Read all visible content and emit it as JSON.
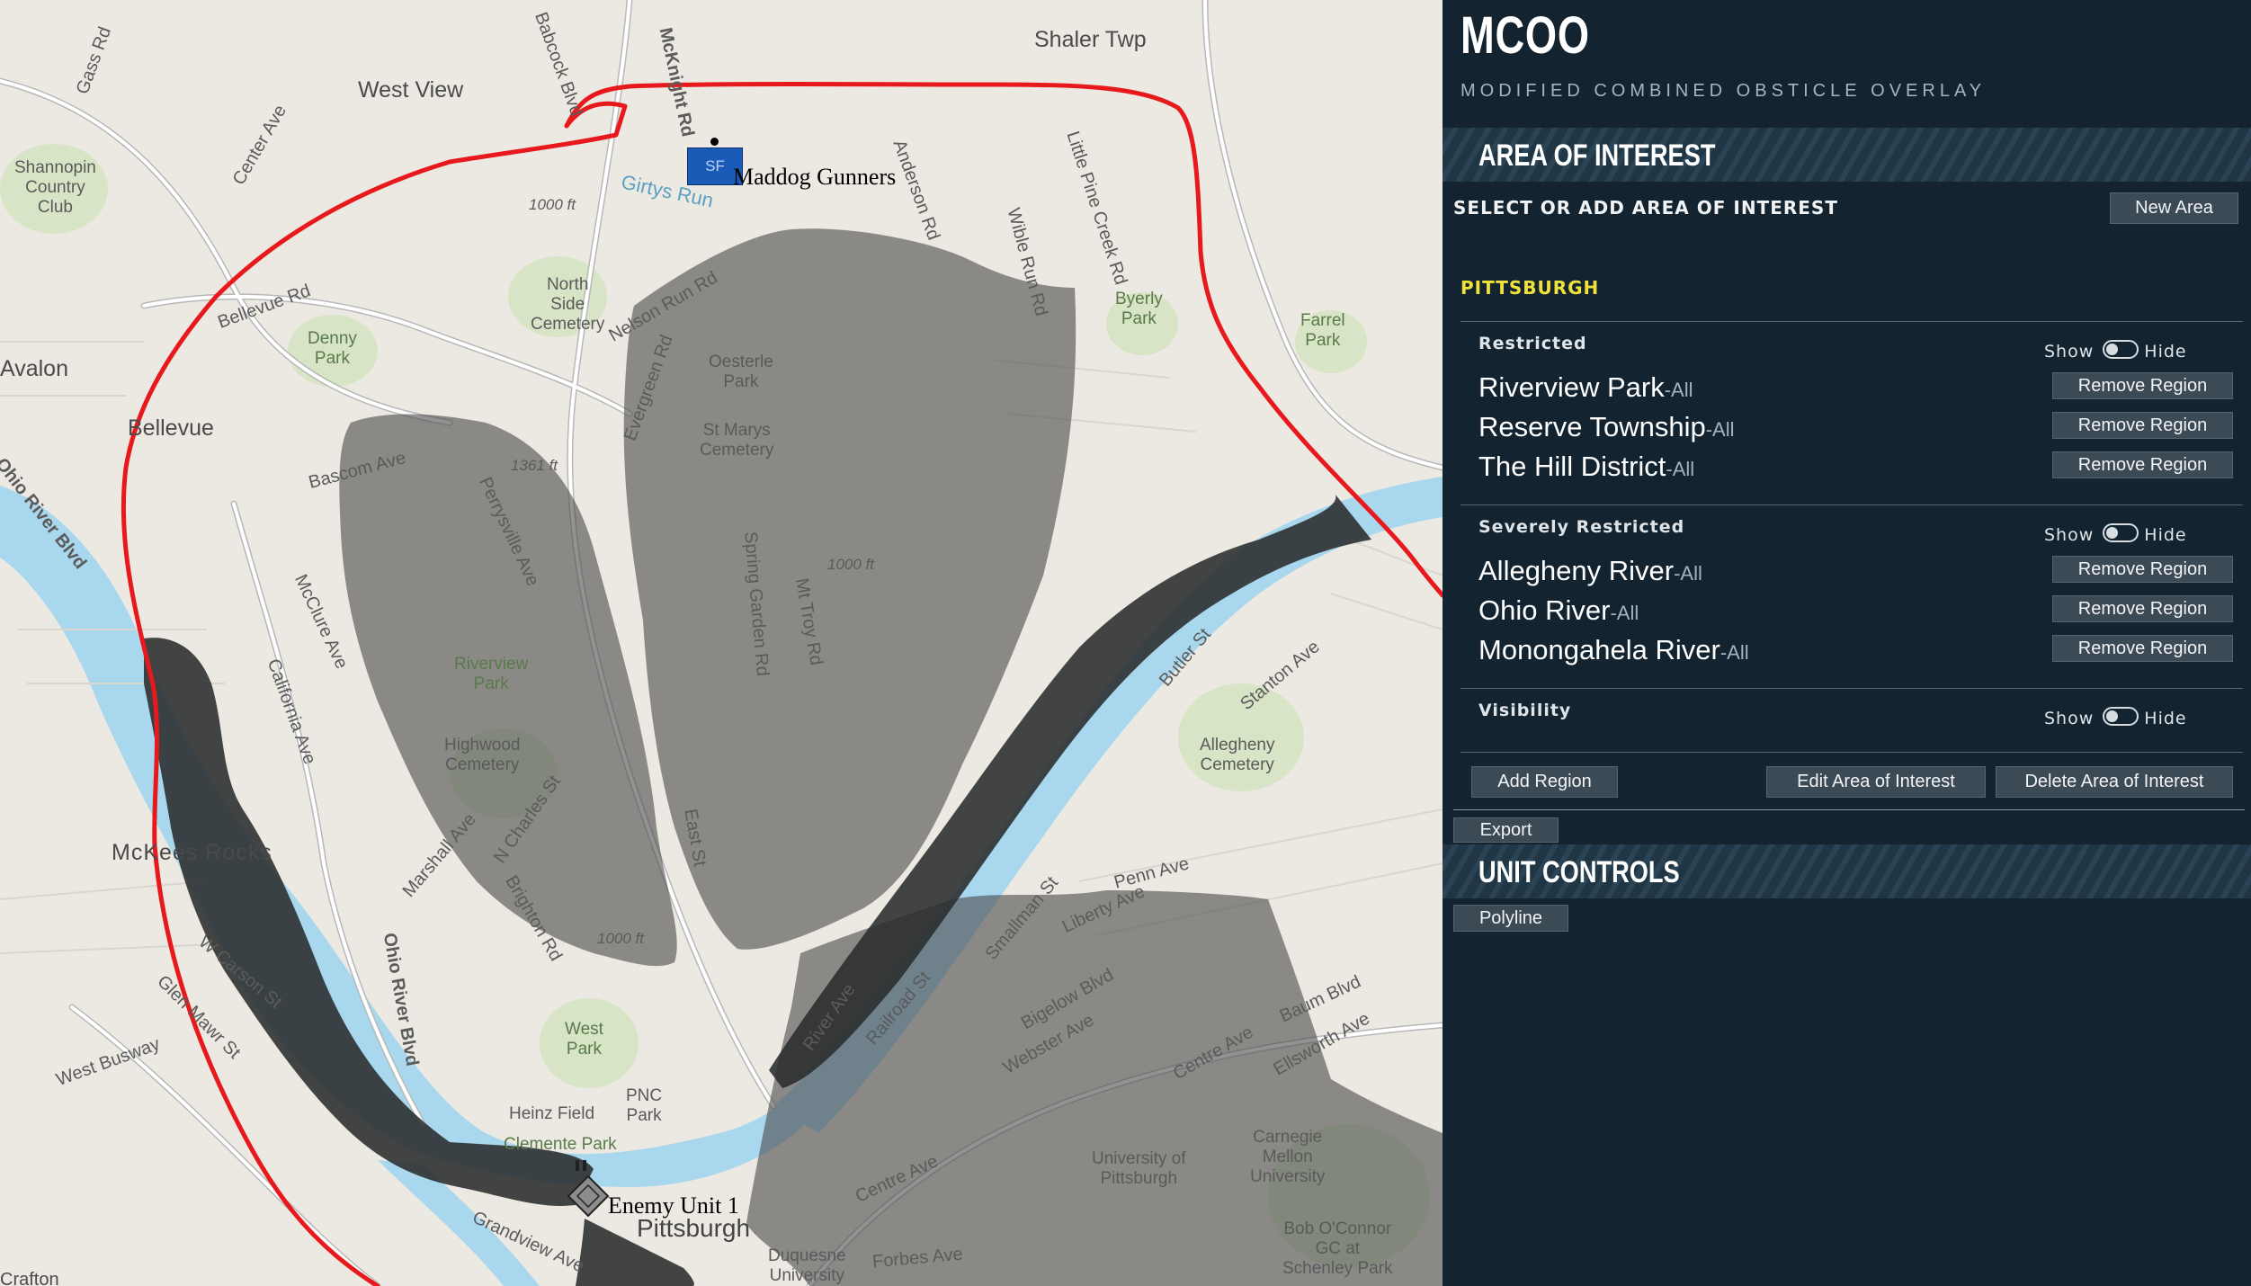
{
  "map": {
    "labels": {
      "shaler": "Shaler Twp",
      "westview": "West View",
      "shannopin": "Shannopin\nCountry\nClub",
      "avalon": "Avalon",
      "bellevue": "Bellevue",
      "mckees": "McKees Rocks",
      "pittsburgh": "Pittsburgh",
      "northside": "North\nSide\nCemetery",
      "denny": "Denny\nPark",
      "oesterle": "Oesterle\nPark",
      "stmarys": "St Marys\nCemetery",
      "riverview": "Riverview\nPark",
      "highwood": "Highwood\nCemetery",
      "byerly": "Byerly\nPark",
      "farrel": "Farrel\nPark",
      "allegheny_cem": "Allegheny\nCemetery",
      "westpark": "West\nPark",
      "heinz": "Heinz Field",
      "pnc": "PNC\nPark",
      "clemente": "Clemente Park",
      "upitt": "University of\nPittsburgh",
      "cmu": "Carnegie\nMellon\nUniversity",
      "bob": "Bob O'Connor\nGC at\nSchenley Park",
      "duquesne": "Duquesne\nUniversity",
      "crafton": "Crafton",
      "girtys": "Girtys Run",
      "ohio_river_blvd": "Ohio River Blvd",
      "mcknight": "McKnight Rd",
      "babcock": "Babcock Blvd",
      "center_ave": "Center Ave",
      "bellevue_rd": "Bellevue Rd",
      "evergreen": "Evergreen Rd",
      "nelson": "Nelson Run Rd",
      "anderson": "Anderson Rd",
      "wible": "Wible Run Rd",
      "little_pine": "Little Pine Creek Rd",
      "bascom": "Bascom Ave",
      "perrysville": "Perrysville Ave",
      "mcclure": "McClure Ave",
      "california": "California Ave",
      "spring_garden": "Spring Garden Rd",
      "mt_troy": "Mt Troy Rd",
      "east_st": "East St",
      "butler": "Butler St",
      "stanton": "Stanton Ave",
      "penn": "Penn Ave",
      "liberty": "Liberty Ave",
      "smallman": "Smallman St",
      "railroad": "Railroad St",
      "river_ave": "River Ave",
      "bigelow": "Bigelow Blvd",
      "webster": "Webster Ave",
      "centre": "Centre Ave",
      "baum": "Baum Blvd",
      "ellsworth": "Ellsworth Ave",
      "forbes": "Forbes Ave",
      "grandview": "Grandview Ave",
      "w_carson": "W Carson St",
      "west_busway": "West Busway",
      "marshall": "Marshall Ave",
      "n_charles": "N Charles St",
      "brighton": "Brighton Rd",
      "glen_mawr": "Glen Mawr St",
      "gass": "Gass Rd",
      "elev1": "1000 ft",
      "elev2": "1361 ft",
      "elev3": "1000 ft",
      "elev4": "1000 ft"
    },
    "units": {
      "friendly_symbol": "SF",
      "friendly_label": "Maddog Gunners",
      "enemy_label": "Enemy Unit 1"
    }
  },
  "panel": {
    "title": "MCOO",
    "subtitle": "MODIFIED COMBINED OBSTICLE OVERLAY",
    "aoi_header": "AREA OF INTEREST",
    "select_label": "SELECT OR ADD AREA OF INTEREST",
    "new_area_button": "New Area",
    "area_name": "PITTSBURGH",
    "show_label": "Show",
    "hide_label": "Hide",
    "groups": [
      {
        "title": "Restricted",
        "regions": [
          {
            "name": "Riverview Park",
            "suffix": "-All"
          },
          {
            "name": "Reserve Township",
            "suffix": "-All"
          },
          {
            "name": "The Hill District",
            "suffix": "-All"
          }
        ]
      },
      {
        "title": "Severely Restricted",
        "regions": [
          {
            "name": "Allegheny River",
            "suffix": "-All"
          },
          {
            "name": "Ohio River",
            "suffix": "-All"
          },
          {
            "name": "Monongahela River",
            "suffix": "-All"
          }
        ]
      },
      {
        "title": "Visibility",
        "regions": []
      }
    ],
    "remove_region_button": "Remove Region",
    "add_region_button": "Add Region",
    "edit_area_button": "Edit Area of Interest",
    "delete_area_button": "Delete Area of Interest",
    "export_button": "Export",
    "unit_controls_header": "UNIT CONTROLS",
    "polyline_button": "Polyline"
  },
  "colors": {
    "panel_bg": "#132430",
    "area_name": "#f0e23a",
    "route": "#e8191c",
    "obstacle": "#3b3b3b",
    "water": "#a9d7ee",
    "friendly_unit": "#1a5bb8"
  }
}
